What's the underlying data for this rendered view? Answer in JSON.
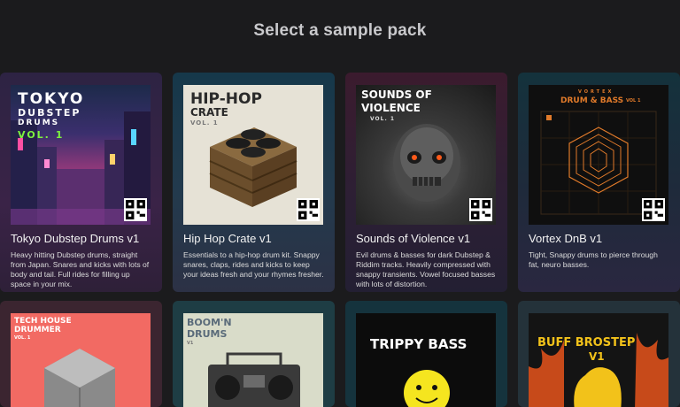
{
  "heading": "Select a sample pack",
  "packs": [
    {
      "title": "Tokyo Dubstep Drums v1",
      "description": "Heavy hitting Dubstep drums, straight from Japan. Snares and kicks with lots of body and tail. Full rides for filling up space in your mix.",
      "art_lines": [
        "TOKYO",
        "DUBSTEP",
        "DRUMS",
        "VOL. 1"
      ]
    },
    {
      "title": "Hip Hop Crate v1",
      "description": "Essentials to a hip-hop drum kit. Snappy snares, claps, rides and kicks to keep your ideas fresh and your rhymes fresher.",
      "art_lines": [
        "HIP-HOP",
        "CRATE",
        "VOL. 1"
      ]
    },
    {
      "title": "Sounds of Violence v1",
      "description": "Evil drums & basses for dark Dubstep & Riddim tracks. Heavily compressed with snappy transients. Vowel focused basses with lots of distortion.",
      "art_lines": [
        "SOUNDS OF",
        "VIOLENCE",
        "VOL. 1"
      ]
    },
    {
      "title": "Vortex DnB v1",
      "description": "Tight, Snappy drums to pierce through fat, neuro basses.",
      "art_lines": [
        "VORTEX",
        "DRUM & BASS",
        "VOL 1"
      ]
    }
  ],
  "packs_row2": [
    {
      "art_lines": [
        "TECH HOUSE",
        "DRUMMER",
        "VOL. 1"
      ]
    },
    {
      "art_lines": [
        "BOOM'N",
        "DRUMS",
        "V1"
      ]
    },
    {
      "art_lines": [
        "TRIPPY BASS"
      ]
    },
    {
      "art_lines": [
        "BUFF BROSTEP",
        "V1"
      ]
    }
  ]
}
